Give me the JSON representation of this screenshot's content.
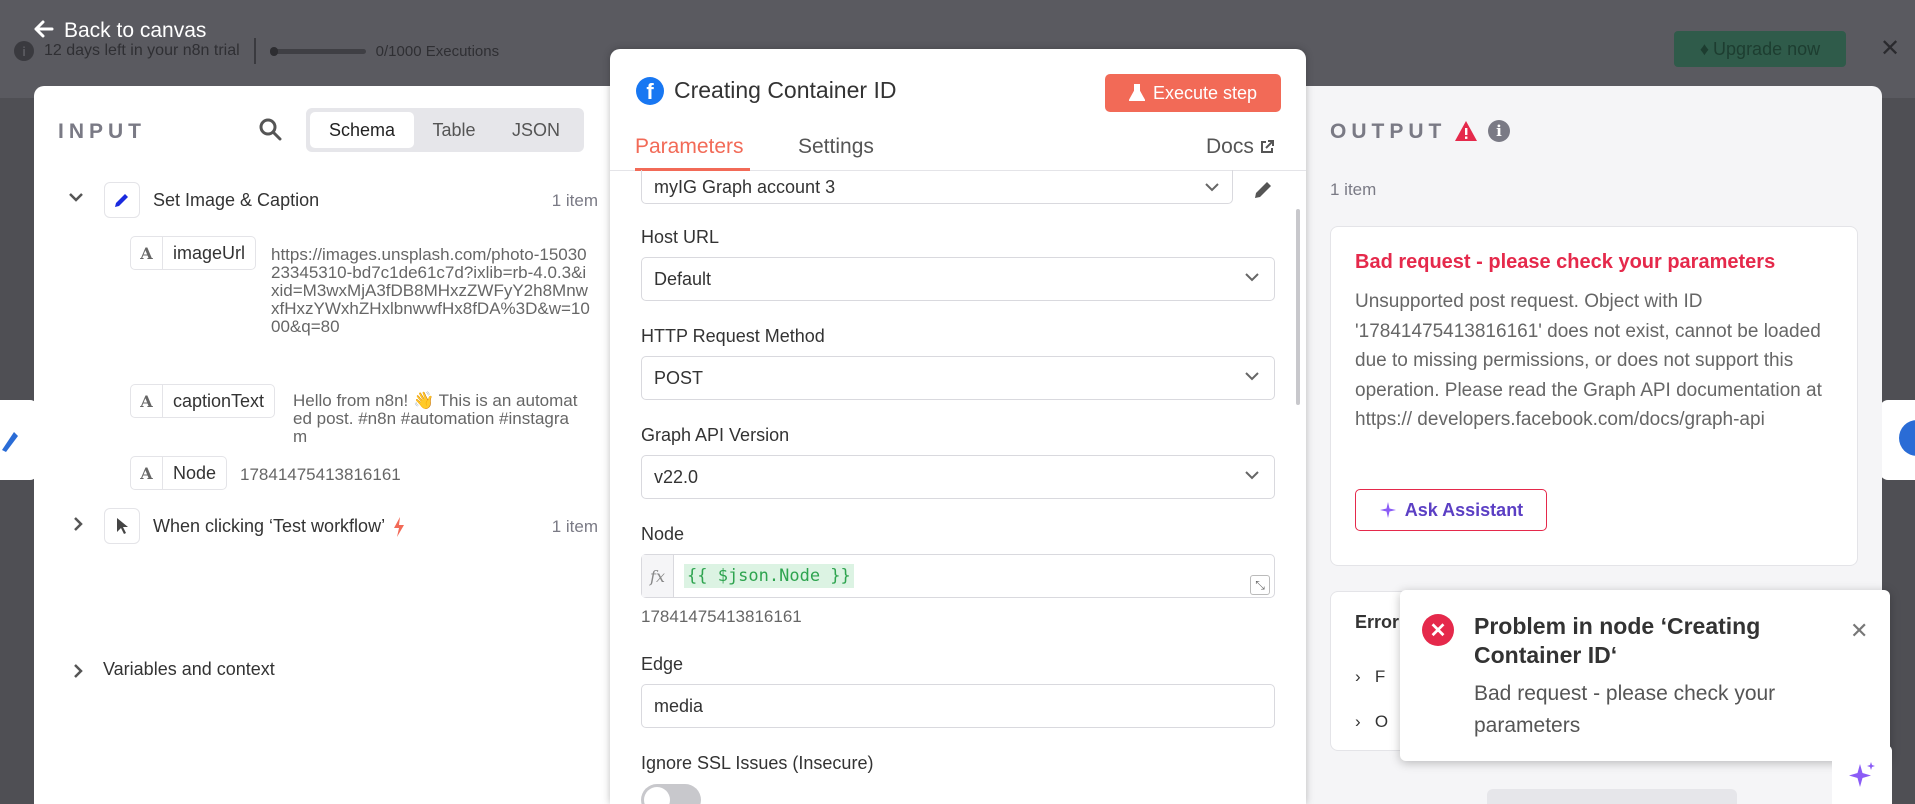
{
  "background": {
    "trial_text": "12 days left in your n8n trial",
    "executions": "0/1000 Executions",
    "upgrade_label": "Upgrade now",
    "back_label": "Back to canvas"
  },
  "input": {
    "title": "INPUT",
    "tabs": [
      "Schema",
      "Table",
      "JSON"
    ],
    "nodes": [
      {
        "name": "Set Image & Caption",
        "count": "1 item",
        "fields": [
          {
            "name": "imageUrl",
            "value": "https://images.unsplash.com/photo-1503023345310-bd7c1de61c7d?ixlib=rb-4.0.3&ixid=M3wxMjA3fDB8MHxzZWFyY2h8MnwxfHxzYWxhZHxlbnwwfHx8fDA%3D&w=1000&q=80"
          },
          {
            "name": "captionText",
            "value": "Hello from n8n! 👋 This is an automated post. #n8n #automation #instagram"
          },
          {
            "name": "Node",
            "value": "17841475413816161"
          }
        ]
      },
      {
        "name": "When clicking ‘Test workflow’",
        "count": "1 item"
      }
    ],
    "variables_label": "Variables and context"
  },
  "center": {
    "title": "Creating Container ID",
    "execute_label": "Execute step",
    "tabs": [
      "Parameters",
      "Settings"
    ],
    "docs_label": "Docs",
    "account_value": "myIG Graph account 3",
    "host_url": {
      "label": "Host URL",
      "value": "Default"
    },
    "http_method": {
      "label": "HTTP Request Method",
      "value": "POST"
    },
    "api_version": {
      "label": "Graph API Version",
      "value": "v22.0"
    },
    "node": {
      "label": "Node",
      "expression": "{{ $json.Node }}",
      "resolved": "17841475413816161",
      "fx": "fx"
    },
    "edge": {
      "label": "Edge",
      "value": "media"
    },
    "ssl": {
      "label": "Ignore SSL Issues (Insecure)",
      "enabled": false
    }
  },
  "output": {
    "title": "OUTPUT",
    "count": "1 item",
    "error_title": "Bad request - please check your parameters",
    "error_desc": "Unsupported post request. Object with ID '17841475413816161' does not exist, cannot be loaded due to missing permissions, or does not support this operation. Please read the Graph API documentation at https:// developers.facebook.com/docs/graph-api",
    "ask_label": "Ask Assistant",
    "details_header": "Error",
    "details_rows": [
      "F",
      "O"
    ]
  },
  "toast": {
    "title": "Problem in node ‘Creating Container ID‘",
    "message": "Bad request - please check your parameters"
  },
  "colors": {
    "accent": "#f26a57",
    "error": "#e5294b",
    "facebook": "#1877f2",
    "assistant": "#5b3fc4"
  }
}
